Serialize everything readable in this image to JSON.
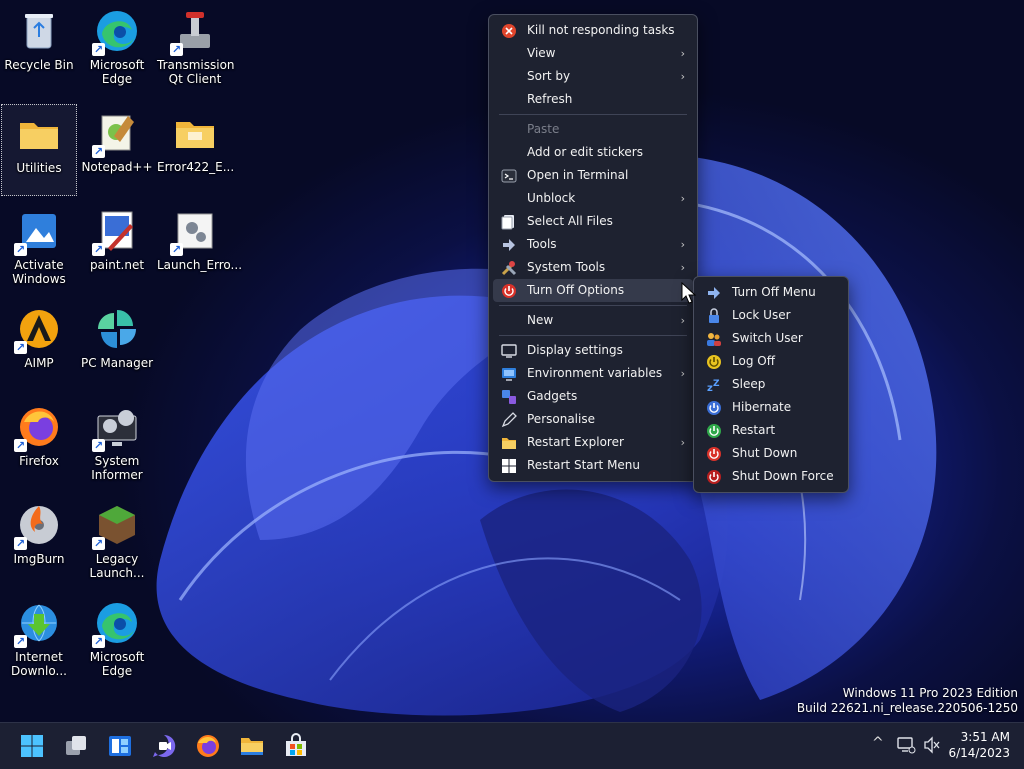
{
  "desktop": {
    "icons": [
      {
        "label": "Recycle Bin"
      },
      {
        "label": "Microsoft Edge"
      },
      {
        "label": "Transmission Qt Client"
      },
      {
        "label": "Utilities"
      },
      {
        "label": "Notepad++"
      },
      {
        "label": "Error422_E..."
      },
      {
        "label": "Activate Windows"
      },
      {
        "label": "paint.net"
      },
      {
        "label": "Launch_Erro..."
      },
      {
        "label": "AIMP"
      },
      {
        "label": "PC Manager"
      },
      {
        "label": "Firefox"
      },
      {
        "label": "System Informer"
      },
      {
        "label": "ImgBurn"
      },
      {
        "label": "Legacy Launch..."
      },
      {
        "label": "Internet Downlo..."
      },
      {
        "label": "Microsoft Edge"
      }
    ]
  },
  "context_menu": {
    "items": [
      {
        "label": "Kill not responding tasks"
      },
      {
        "label": "View"
      },
      {
        "label": "Sort by"
      },
      {
        "label": "Refresh"
      },
      {
        "label": "Paste"
      },
      {
        "label": "Add or edit stickers"
      },
      {
        "label": "Open in Terminal"
      },
      {
        "label": "Unblock"
      },
      {
        "label": "Select All Files"
      },
      {
        "label": "Tools"
      },
      {
        "label": "System Tools"
      },
      {
        "label": "Turn Off Options"
      },
      {
        "label": "New"
      },
      {
        "label": "Display settings"
      },
      {
        "label": "Environment variables"
      },
      {
        "label": "Gadgets"
      },
      {
        "label": "Personalise"
      },
      {
        "label": "Restart Explorer"
      },
      {
        "label": "Restart Start Menu"
      }
    ]
  },
  "submenu": {
    "items": [
      {
        "label": "Turn Off Menu"
      },
      {
        "label": "Lock User"
      },
      {
        "label": "Switch User"
      },
      {
        "label": "Log Off"
      },
      {
        "label": "Sleep"
      },
      {
        "label": "Hibernate"
      },
      {
        "label": "Restart"
      },
      {
        "label": "Shut Down"
      },
      {
        "label": "Shut Down Force"
      }
    ]
  },
  "watermark": {
    "edition": "Windows 11 Pro 2023 Edition",
    "build": "Build 22621.ni_release.220506-1250"
  },
  "taskbar": {
    "time": "3:51 AM",
    "date": "6/14/2023",
    "tray_chevron": "^"
  },
  "colors": {
    "menu_bg": "#1e2230",
    "menu_hover": "#353a4b",
    "taskbar_bg": "#1c2033",
    "accent": "#2a3fd8"
  }
}
